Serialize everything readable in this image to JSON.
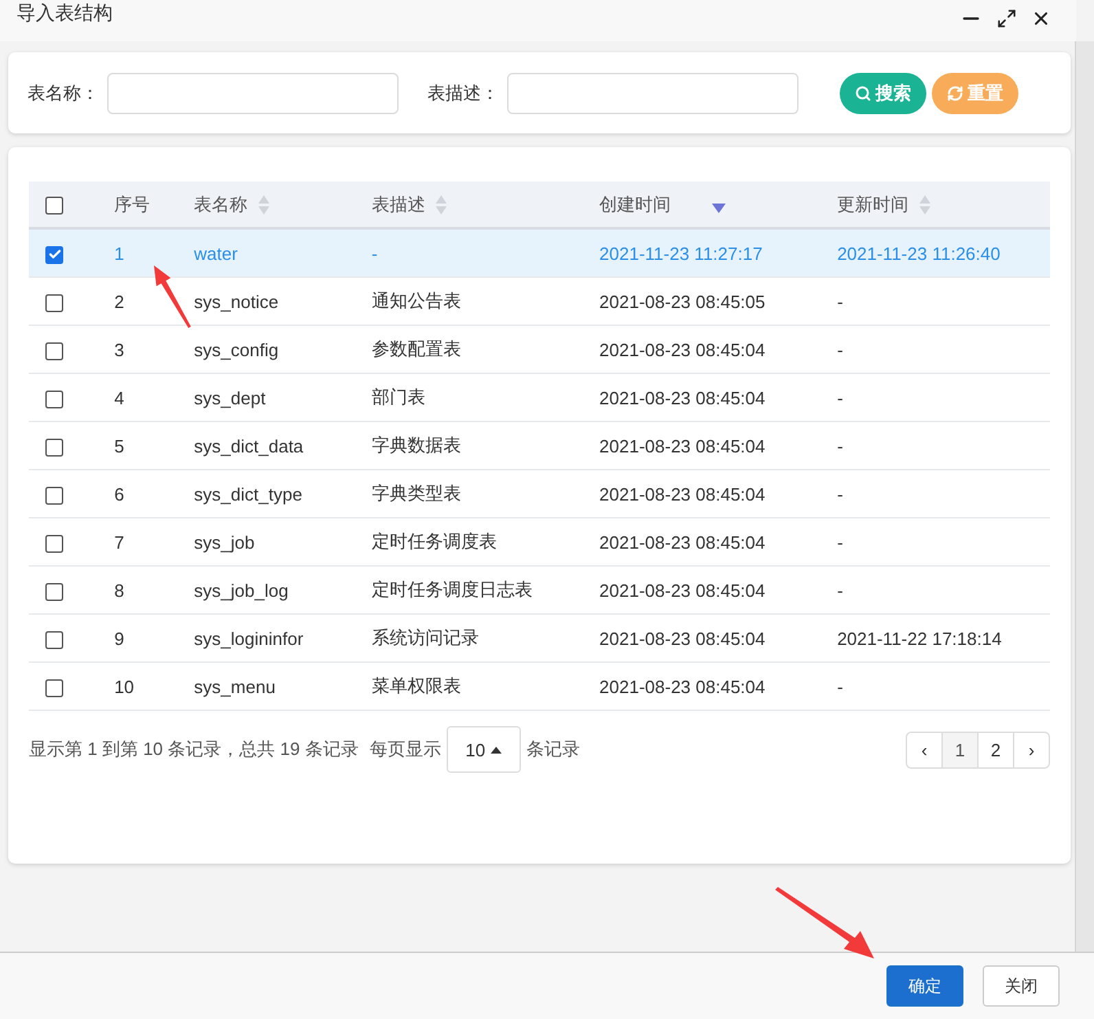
{
  "window": {
    "title": "导入表结构"
  },
  "search": {
    "fields": [
      {
        "label": "表名称："
      },
      {
        "label": "表描述："
      }
    ],
    "buttons": [
      {
        "kind": "search",
        "label": "搜索",
        "color": "#1ab394"
      },
      {
        "kind": "reset",
        "label": "重置",
        "color": "#f8ac59"
      }
    ]
  },
  "table": {
    "all_checked": false,
    "columns": [
      {
        "label": "序号",
        "kind": "plain"
      },
      {
        "label": "表名称",
        "kind": "sortable"
      },
      {
        "label": "表描述",
        "kind": "sortable"
      },
      {
        "label": "创建时间",
        "kind": "descending"
      },
      {
        "label": "更新时间",
        "kind": "sortable"
      }
    ],
    "rows": [
      {
        "selected": true,
        "checked": true,
        "cells": [
          "1",
          "water",
          "-",
          "2021-11-23 11:27:17",
          "2021-11-23 11:26:40"
        ]
      },
      {
        "selected": false,
        "checked": false,
        "cells": [
          "2",
          "sys_notice",
          "通知公告表",
          "2021-08-23 08:45:05",
          "-"
        ]
      },
      {
        "selected": false,
        "checked": false,
        "cells": [
          "3",
          "sys_config",
          "参数配置表",
          "2021-08-23 08:45:04",
          "-"
        ]
      },
      {
        "selected": false,
        "checked": false,
        "cells": [
          "4",
          "sys_dept",
          "部门表",
          "2021-08-23 08:45:04",
          "-"
        ]
      },
      {
        "selected": false,
        "checked": false,
        "cells": [
          "5",
          "sys_dict_data",
          "字典数据表",
          "2021-08-23 08:45:04",
          "-"
        ]
      },
      {
        "selected": false,
        "checked": false,
        "cells": [
          "6",
          "sys_dict_type",
          "字典类型表",
          "2021-08-23 08:45:04",
          "-"
        ]
      },
      {
        "selected": false,
        "checked": false,
        "cells": [
          "7",
          "sys_job",
          "定时任务调度表",
          "2021-08-23 08:45:04",
          "-"
        ]
      },
      {
        "selected": false,
        "checked": false,
        "cells": [
          "8",
          "sys_job_log",
          "定时任务调度日志表",
          "2021-08-23 08:45:04",
          "-"
        ]
      },
      {
        "selected": false,
        "checked": false,
        "cells": [
          "9",
          "sys_logininfor",
          "系统访问记录",
          "2021-08-23 08:45:04",
          "2021-11-22 17:18:14"
        ]
      },
      {
        "selected": false,
        "checked": false,
        "cells": [
          "10",
          "sys_menu",
          "菜单权限表",
          "2021-08-23 08:45:04",
          "-"
        ]
      }
    ]
  },
  "pagination": {
    "summary": "显示第 1 到第 10 条记录，总共 19 条记录",
    "per_page_label": "每页显示",
    "page_size": "10",
    "per_page_suffix": "条记录",
    "pages": [
      {
        "label": "‹",
        "selected": false
      },
      {
        "label": "1",
        "selected": true
      },
      {
        "label": "2",
        "selected": false
      },
      {
        "label": "›",
        "selected": false
      }
    ]
  },
  "footer": {
    "buttons": [
      {
        "kind": "primary",
        "label": "确定"
      },
      {
        "kind": "default",
        "label": "关闭"
      }
    ]
  }
}
